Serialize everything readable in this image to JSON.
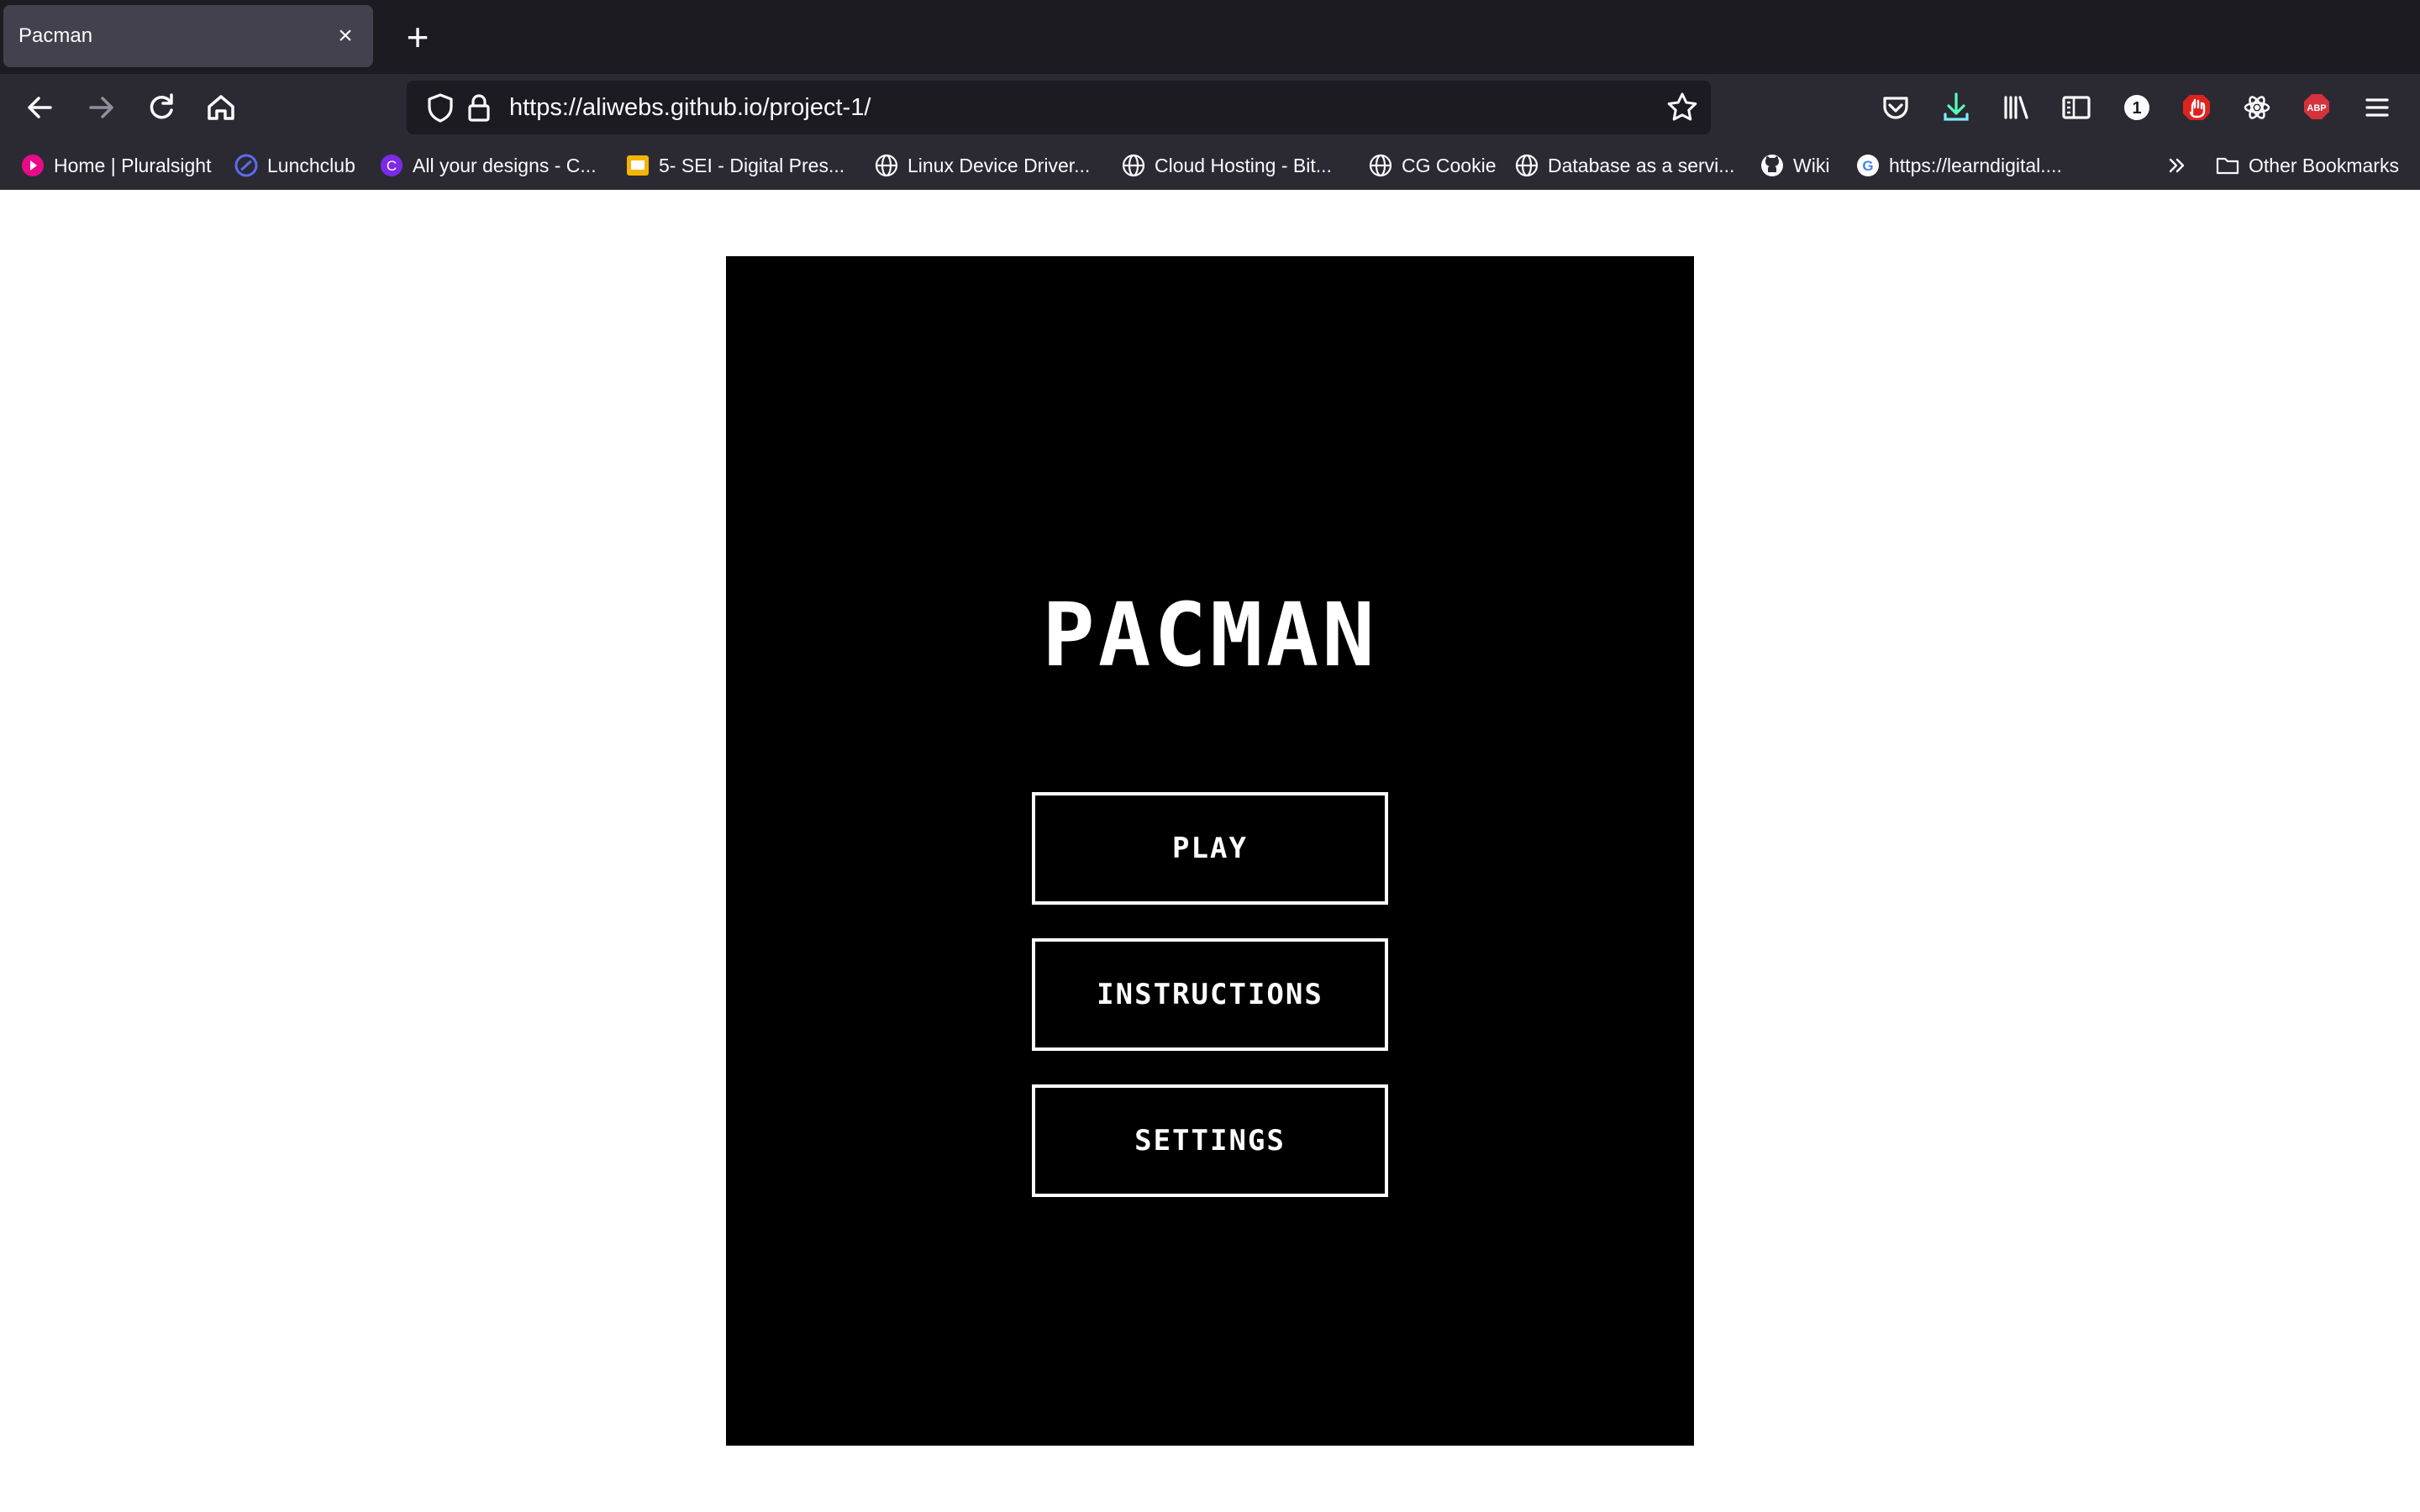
{
  "browser": {
    "tab": {
      "title": "Pacman",
      "close_icon": "close-icon"
    },
    "new_tab_icon": "plus-icon",
    "nav": {
      "back_icon": "arrow-left-icon",
      "forward_icon": "arrow-right-icon",
      "reload_icon": "reload-icon",
      "home_icon": "home-icon"
    },
    "url": "https://aliwebs.github.io/project-1/",
    "url_icons": [
      "shield-icon",
      "lock-icon",
      "star-icon"
    ],
    "toolbar_icons": [
      "pocket-icon",
      "download-icon",
      "library-icon",
      "sidebar-icon",
      "password-manager-icon",
      "ublock-icon",
      "react-devtools-icon",
      "adblock-icon",
      "menu-icon"
    ],
    "password_manager_badge": "1",
    "adblock_badge": "ABP",
    "bookmarks": [
      {
        "label": "Home | Pluralsight",
        "icon": "pluralsight-icon"
      },
      {
        "label": "Lunchclub",
        "icon": "lunchclub-icon"
      },
      {
        "label": "All your designs - C...",
        "icon": "canva-icon"
      },
      {
        "label": "5- SEI - Digital Pres...",
        "icon": "slides-icon"
      },
      {
        "label": "Linux Device Driver...",
        "icon": "globe-icon"
      },
      {
        "label": "Cloud Hosting - Bit...",
        "icon": "globe-icon"
      },
      {
        "label": "CG Cookie",
        "icon": "globe-icon"
      },
      {
        "label": "Database as a servi...",
        "icon": "globe-icon"
      },
      {
        "label": "Wiki",
        "icon": "github-icon"
      },
      {
        "label": "https://learndigital....",
        "icon": "google-icon"
      }
    ],
    "overflow_icon": "chevron-double-right-icon",
    "other_bookmarks": {
      "label": "Other Bookmarks",
      "icon": "folder-icon"
    }
  },
  "game": {
    "title": "PACMAN",
    "buttons": {
      "play": "PLAY",
      "instructions": "INSTRUCTIONS",
      "settings": "SETTINGS"
    }
  },
  "colors": {
    "chrome_dark": "#1c1b22",
    "toolbar": "#2b2a33",
    "game_bg": "#000000",
    "game_fg": "#ffffff"
  }
}
